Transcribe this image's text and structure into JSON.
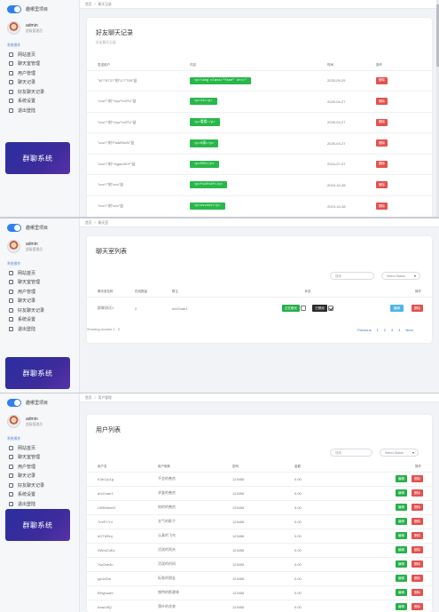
{
  "app": {
    "brand": "趣哪里项目",
    "user_name": "admin",
    "user_role": "超级管理员",
    "section_label": "系统操作",
    "banner": "群聊系统",
    "crumb_home": "首页",
    "crumb_sep": "/"
  },
  "panel1": {
    "menu": [
      "网站首页",
      "聊天室管理",
      "用户管理",
      "聊天记录",
      "好友聊天记录",
      "系统设置",
      "退出登陆"
    ],
    "crumb_current": "聊天记录",
    "title": "好友聊天记录",
    "subtitle": "好友聊天记录",
    "headers": [
      "发送用户",
      "内容",
      "时间",
      "操作"
    ],
    "rows": [
      {
        "sender": "\"W\"/\"673\"/\"刻\"U\"/\"T65\"益",
        "content": "<p><img class=\"face\" src=\"",
        "time": "2025-09-29",
        "action": "删除"
      },
      {
        "sender": "\"coo\"/\"刻\"^mp/\"m3TU\"益",
        "content": "<p>11</p>",
        "time": "2025-04-27",
        "action": "删除"
      },
      {
        "sender": "\"coo\"/\"刻\"^mp/\"m3TU\"益",
        "content": "<p>看看</p>",
        "time": "2025-04-27",
        "action": "删除"
      },
      {
        "sender": "\"coo\"/\"刻\"FtuMSsvN\"益",
        "content": "<p>0清</p>",
        "time": "2025-04-27",
        "action": "删除"
      },
      {
        "sender": "\"coo\"/\"刻\"^Agom9CF\"益",
        "content": "<p>555</p>",
        "time": "2024-07-07",
        "action": "删除"
      },
      {
        "sender": "\"coo\"/\"刻\"coo\"益",
        "content": "<p>fsdfsdf</p>",
        "time": "2019-10-28",
        "action": "删除"
      },
      {
        "sender": "\"coo\"/\"刻\"coo\"益",
        "content": "<p>csvsev</p>",
        "time": "2019-10-28",
        "action": "删除"
      }
    ]
  },
  "panel2": {
    "menu": [
      "网站首页",
      "聊天室管理",
      "用户管理",
      "聊天记录",
      "好友聊天记录",
      "系统设置",
      "退出登陆"
    ],
    "crumb_current": "聊天室",
    "title": "聊天室列表",
    "search_placeholder": "搜索",
    "select_label": "Select Status",
    "headers": [
      "聊天室名称",
      "在线数量",
      "群主",
      "状态",
      "操作"
    ],
    "row": {
      "name": "群聊测试1",
      "count": "2",
      "owner": "uhrOxae1",
      "status_a": "正在聊天",
      "status_b": "已禁用",
      "edit": "编辑",
      "delete": "删除"
    },
    "showing": "Showing records 1 - 5",
    "pager": [
      "Previous",
      "1",
      "2",
      "3",
      "4",
      "Next"
    ]
  },
  "panel3": {
    "menu": [
      "网站首页",
      "聊天室管理",
      "用户管理",
      "聊天记录",
      "好友聊天记录",
      "系统设置",
      "退出登陆"
    ],
    "crumb_current": "用户管理",
    "title": "用户列表",
    "search_placeholder": "搜索",
    "select_label": "Select Status",
    "headers": [
      "用户名",
      "用户昵称",
      "密码",
      "金额",
      "操作"
    ],
    "rows": [
      {
        "user": "K3e1Jp1g",
        "nick": "不会的善良",
        "pwd": "123456",
        "money": "0.00"
      },
      {
        "user": "uhrOxae1",
        "nick": "求爱的善良",
        "pwd": "123456",
        "money": "0.00"
      },
      {
        "user": "Uh96dnmG",
        "nick": "刻的的善良",
        "pwd": "123456",
        "money": "0.00"
      },
      {
        "user": "7m/FCY4",
        "nick": "文气的影子",
        "pwd": "123456",
        "money": "0.00"
      },
      {
        "user": "hGTkRinj",
        "nick": "认真的飞鸟",
        "pwd": "123456",
        "money": "0.00"
      },
      {
        "user": "SWmCnEz",
        "nick": "活泼的男夫",
        "pwd": "123456",
        "money": "0.00"
      },
      {
        "user": "YwOne4u",
        "nick": "活泼的时间",
        "pwd": "123456",
        "money": "0.00"
      },
      {
        "user": "ypUrtZw",
        "nick": "标准的朋友",
        "pwd": "123456",
        "money": "0.00"
      },
      {
        "user": "BHyjuuaV",
        "nick": "独特的影碧林",
        "pwd": "123456",
        "money": "0.00"
      },
      {
        "user": "hxwLt8Q",
        "nick": "落叶的花束",
        "pwd": "123456",
        "money": "0.00"
      }
    ],
    "edit": "编辑",
    "delete": "删除"
  }
}
